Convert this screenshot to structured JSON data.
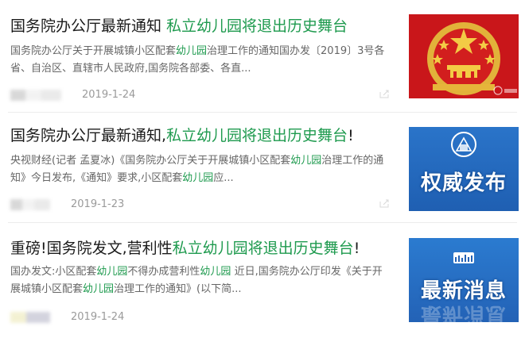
{
  "results": [
    {
      "title_prefix": "国务院办公厅最新通知 ",
      "title_highlight": "私立幼儿园将退出历史舞台",
      "title_suffix": "",
      "snippet_parts": [
        {
          "text": "国务院办公厅关于开展城镇小区配套",
          "hl": false
        },
        {
          "text": "幼儿园",
          "hl": true
        },
        {
          "text": "治理工作的通知国办发〔2019〕3号各省、自治区、直辖市人民政府,国务院各部委、各直...",
          "hl": false
        }
      ],
      "date": "2019-1-24",
      "thumb_caption": ""
    },
    {
      "title_prefix": "国务院办公厅最新通知,",
      "title_highlight": "私立幼儿园将退出历史舞台",
      "title_suffix": "!",
      "snippet_parts": [
        {
          "text": "央视财经(记者 孟夏冰)《国务院办公厅关于开展城镇小区配套",
          "hl": false
        },
        {
          "text": "幼儿园",
          "hl": true
        },
        {
          "text": "治理工作的通知》今日发布,《通知》要求,小区配套",
          "hl": false
        },
        {
          "text": "幼儿园",
          "hl": true
        },
        {
          "text": "应...",
          "hl": false
        }
      ],
      "date": "2019-1-23",
      "thumb_caption": "权威发布"
    },
    {
      "title_prefix": "重磅!国务院发文,营利性",
      "title_highlight": "私立幼儿园将退出历史舞台",
      "title_suffix": "!",
      "snippet_parts": [
        {
          "text": "国办发文:小区配套",
          "hl": false
        },
        {
          "text": "幼儿园",
          "hl": true
        },
        {
          "text": "不得办成营利性",
          "hl": false
        },
        {
          "text": "幼儿园",
          "hl": true
        },
        {
          "text": " 近日,国务院办公厅印发《关于开展城镇小区配套",
          "hl": false
        },
        {
          "text": "幼儿园",
          "hl": true
        },
        {
          "text": "治理工作的通知》(以下简...",
          "hl": false
        }
      ],
      "date": "2019-1-24",
      "thumb_caption": "最新消息",
      "thumb_reflection": "最新消息"
    }
  ],
  "colors": {
    "highlight": "#1e9a4e",
    "text": "#1b1b1b",
    "snippet": "#666666",
    "date": "#9a9a9a"
  },
  "icons": {
    "share": "share-icon",
    "emblem": "national-emblem-icon",
    "building": "building-logo-icon"
  }
}
